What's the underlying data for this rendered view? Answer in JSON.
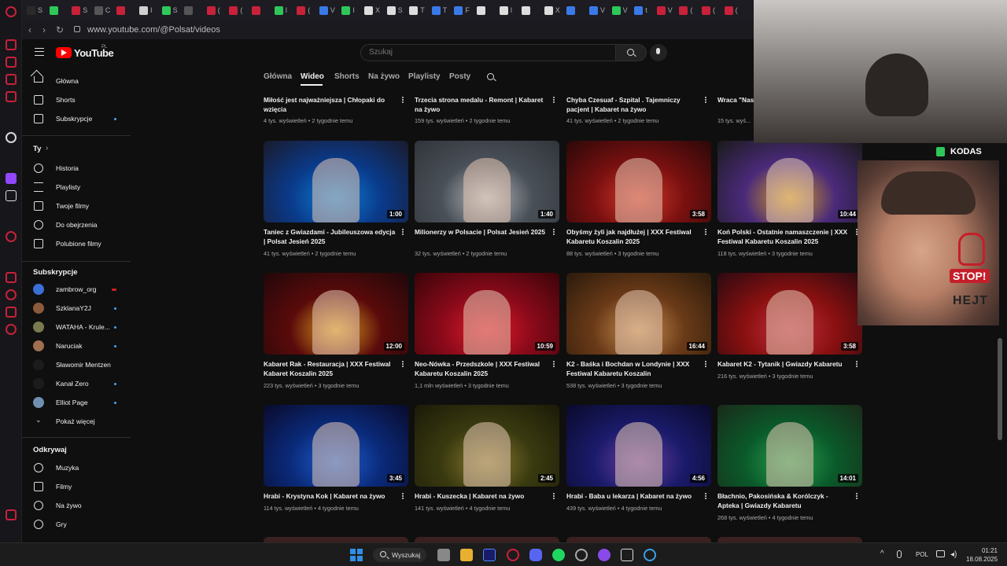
{
  "browser": {
    "url": "www.youtube.com/@Polsat/videos",
    "tab_labels": [
      "S",
      "",
      "S",
      "C",
      "",
      "I",
      "S",
      "",
      "(",
      "(",
      "",
      "I",
      "(",
      "V",
      "I",
      "X",
      "S",
      "T",
      "T",
      "F",
      "",
      "I",
      "",
      "X",
      "",
      "V",
      "V",
      "t",
      "V",
      "(",
      "(",
      "("
    ]
  },
  "youtube": {
    "logo_text": "YouTube",
    "country_code": "PL",
    "search_placeholder": "Szukaj"
  },
  "sidebar": {
    "main": [
      {
        "label": "Główna",
        "icon": "home-icon"
      },
      {
        "label": "Shorts",
        "icon": "shorts-icon"
      },
      {
        "label": "Subskrypcje",
        "icon": "subscriptions-icon"
      }
    ],
    "you_heading": "Ty",
    "you": [
      {
        "label": "Historia",
        "icon": "history-icon"
      },
      {
        "label": "Playlisty",
        "icon": "playlists-icon"
      },
      {
        "label": "Twoje filmy",
        "icon": "your-videos-icon"
      },
      {
        "label": "Do obejrzenia",
        "icon": "watch-later-icon"
      },
      {
        "label": "Polubione filmy",
        "icon": "liked-icon"
      }
    ],
    "subs_heading": "Subskrypcje",
    "subs": [
      {
        "label": "zambrow_org",
        "avatar": "#3a6fd8",
        "indicator": "live"
      },
      {
        "label": "SzklanaY2J",
        "avatar": "#8a5a3a",
        "indicator": "dot"
      },
      {
        "label": "WATAHA - Krule...",
        "avatar": "#7a7a50",
        "indicator": "dot"
      },
      {
        "label": "Naruciak",
        "avatar": "#a07050",
        "indicator": "dot"
      },
      {
        "label": "Sławomir Mentzen",
        "avatar": "#1c1c1c",
        "indicator": ""
      },
      {
        "label": "Kanał Zero",
        "avatar": "#1c1c1c",
        "indicator": "dot"
      },
      {
        "label": "Elliot Page",
        "avatar": "#7090b0",
        "indicator": "dot"
      }
    ],
    "show_more": "Pokaż więcej",
    "explore_heading": "Odkrywaj",
    "explore": [
      {
        "label": "Muzyka",
        "icon": "music-icon"
      },
      {
        "label": "Filmy",
        "icon": "movies-icon"
      },
      {
        "label": "Na żywo",
        "icon": "live-icon"
      },
      {
        "label": "Gry",
        "icon": "gaming-icon"
      }
    ]
  },
  "channel_tabs": [
    "Główna",
    "Wideo",
    "Shorts",
    "Na żywo",
    "Playlisty",
    "Posty"
  ],
  "active_tab": "Wideo",
  "top_row": [
    {
      "title": "Miłość jest najważniejsza | Chłopaki do wzięcia",
      "views": "4 tys. wyświetleń",
      "age": "2 tygodnie temu"
    },
    {
      "title": "Trzecia strona medalu - Remont | Kabaret na żywo",
      "views": "159 tys. wyświetleń",
      "age": "2 tygodnie temu"
    },
    {
      "title": "Chyba Czesuaf - Szpital . Tajemniczy pacjent | Kabaret na żywo",
      "views": "41 tys. wyświetleń",
      "age": "2 tygodnie temu"
    },
    {
      "title": "Wraca \"Nasz... września w...",
      "views": "15 tys. wyś...",
      "age": ""
    }
  ],
  "videos": [
    {
      "title": "Taniec z Gwiazdami - Jubileuszowa edycja | Polsat Jesień 2025",
      "views": "41 tys. wyświetleń",
      "age": "2 tygodnie temu",
      "duration": "1:00",
      "thumb": [
        "#0a3a8a",
        "#0e7fd6",
        "#1a1a2a"
      ]
    },
    {
      "title": "Milionerzy w Polsacie | Polsat Jesień 2025",
      "views": "32 tys. wyświetleń",
      "age": "2 tygodnie temu",
      "duration": "1:40",
      "thumb": [
        "#4a5058",
        "#b8bcc0",
        "#30343a"
      ]
    },
    {
      "title": "Obyśmy żyli jak najdłużej | XXX Festiwal Kabaretu Koszalin 2025",
      "views": "88 tys. wyświetleń",
      "age": "3 tygodnie temu",
      "duration": "3:58",
      "thumb": [
        "#7a1010",
        "#d43a2a",
        "#2a0808"
      ]
    },
    {
      "title": "Koń Polski - Ostatnie namaszczenie | XXX Festiwal Kabaretu Koszalin 2025",
      "views": "118 tys. wyświetleń",
      "age": "3 tygodnie temu",
      "duration": "10:44",
      "thumb": [
        "#4a2a7a",
        "#d8a020",
        "#1a1a1a"
      ]
    },
    {
      "title": "Kabaret Rak - Restauracja | XXX Festiwal Kabaret Koszalin 2025",
      "views": "223 tys. wyświetleń",
      "age": "3 tygodnie temu",
      "duration": "12:00",
      "thumb": [
        "#5a0a0a",
        "#e0a020",
        "#20080a"
      ]
    },
    {
      "title": "Neo-Nówka - Przedszkole | XXX Festiwal Kabaretu Koszalin 2025",
      "views": "1,1 mln wyświetleń",
      "age": "3 tygodnie temu",
      "duration": "10:59",
      "thumb": [
        "#8a0a1a",
        "#e01a2a",
        "#3a0408"
      ]
    },
    {
      "title": "K2 - Baśka i Bochdan w Londynie | XXX Festiwal Kabaretu Koszalin",
      "views": "538 tys. wyświetleń",
      "age": "3 tygodnie temu",
      "duration": "16:44",
      "thumb": [
        "#6a3a18",
        "#c89050",
        "#2a1a0a"
      ]
    },
    {
      "title": "Kabaret K2 - Tytanik | Gwiazdy Kabaretu",
      "views": "216 tys. wyświetleń",
      "age": "3 tygodnie temu",
      "duration": "3:58",
      "thumb": [
        "#8a1010",
        "#c03040",
        "#2a0a10"
      ]
    },
    {
      "title": "Hrabi - Krystyna Kok | Kabaret na żywo",
      "views": "114 tys. wyświetleń",
      "age": "4 tygodnie temu",
      "duration": "3:45",
      "thumb": [
        "#0a2a7a",
        "#2060d0",
        "#0a0a2a"
      ]
    },
    {
      "title": "Hrabi - Kuszecka | Kabaret na żywo",
      "views": "141 tys. wyświetleń",
      "age": "4 tygodnie temu",
      "duration": "2:45",
      "thumb": [
        "#3a3a10",
        "#8a7a30",
        "#1a1a08"
      ]
    },
    {
      "title": "Hrabi - Baba u lekarza | Kabaret na żywo",
      "views": "439 tys. wyświetleń",
      "age": "4 tygodnie temu",
      "duration": "4:56",
      "thumb": [
        "#1a1a6a",
        "#6a40a0",
        "#0a0a2a"
      ]
    },
    {
      "title": "Błachnio, Pakosińska & Korólczyk - Apteka | Gwiazdy Kabaretu",
      "views": "268 tys. wyświetleń",
      "age": "4 tygodnie temu",
      "duration": "14:01",
      "thumb": [
        "#0a5a2a",
        "#2aa050",
        "#1a2a1a"
      ]
    }
  ],
  "overlay": {
    "brand": "KODAS",
    "badge_stop": "STOP!",
    "badge_hejt": "HEJT"
  },
  "taskbar": {
    "search_label": "Wyszukaj",
    "lang": "POL",
    "time": "01:21",
    "date": "18.08.2025"
  }
}
